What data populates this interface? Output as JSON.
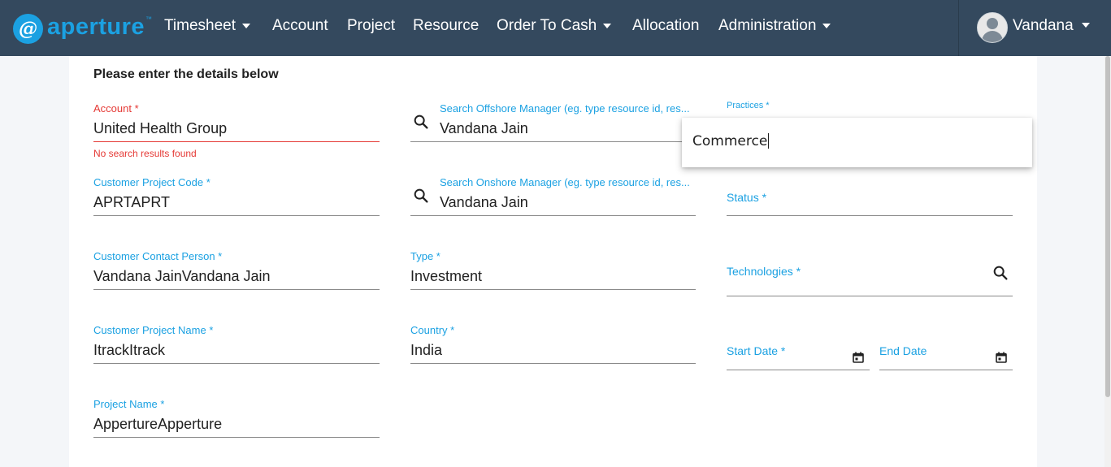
{
  "brand": {
    "name": "aperture",
    "badge": "@",
    "tm": "™"
  },
  "nav": {
    "items": [
      {
        "label": "Timesheet",
        "has_dropdown": true
      },
      {
        "label": "Account",
        "has_dropdown": false
      },
      {
        "label": "Project",
        "has_dropdown": false
      },
      {
        "label": "Resource",
        "has_dropdown": false
      },
      {
        "label": "Order To Cash",
        "has_dropdown": true
      },
      {
        "label": "Allocation",
        "has_dropdown": false
      },
      {
        "label": "Administration",
        "has_dropdown": true
      }
    ],
    "user": {
      "name": "Vandana",
      "has_dropdown": true
    }
  },
  "form": {
    "heading": "Please enter the details below",
    "account": {
      "label": "Account *",
      "value": "United Health Group",
      "error": "No search results found"
    },
    "customer_project_code": {
      "label": "Customer Project Code *",
      "value": "APRTAPRT"
    },
    "customer_contact_person": {
      "label": "Customer Contact Person *",
      "value": "Vandana JainVandana Jain"
    },
    "customer_project_name": {
      "label": "Customer Project Name *",
      "value": "ItrackItrack"
    },
    "project_name": {
      "label": "Project Name *",
      "value": "AppertureApperture"
    },
    "offshore_manager": {
      "label": "Search Offshore Manager (eg. type resource id, res...",
      "value": "Vandana Jain"
    },
    "onshore_manager": {
      "label": "Search Onshore Manager (eg. type resource id, res...",
      "value": "Vandana Jain"
    },
    "type": {
      "label": "Type *",
      "value": "Investment"
    },
    "country": {
      "label": "Country *",
      "value": "India"
    },
    "practices": {
      "label": "Practices *",
      "popup_value": "Commerce"
    },
    "status": {
      "label": "Status *",
      "value": ""
    },
    "technologies": {
      "label": "Technologies *",
      "value": ""
    },
    "start_date": {
      "label": "Start Date *",
      "value": ""
    },
    "end_date": {
      "label": "End Date",
      "value": ""
    }
  },
  "colors": {
    "navbar": "#34495e",
    "accent": "#1ba1e2",
    "error": "#e53935"
  },
  "icons": [
    "search-icon",
    "calendar-icon",
    "user-avatar-icon",
    "caret-down-icon"
  ]
}
